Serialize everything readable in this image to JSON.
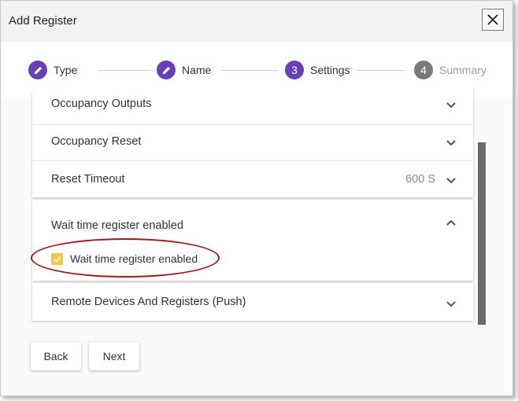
{
  "dialog": {
    "title": "Add Register",
    "close_icon": "close-icon"
  },
  "stepper": {
    "steps": [
      {
        "label": "Type",
        "marker": "edit-icon",
        "state": "completed"
      },
      {
        "label": "Name",
        "marker": "edit-icon",
        "state": "completed"
      },
      {
        "label": "Settings",
        "number": "3",
        "state": "active"
      },
      {
        "label": "Summary",
        "number": "4",
        "state": "inactive"
      }
    ]
  },
  "panels": [
    {
      "title": "Occupancy Outputs",
      "value": "",
      "expanded": false
    },
    {
      "title": "Occupancy Reset",
      "value": "",
      "expanded": false
    },
    {
      "title": "Reset Timeout",
      "value": "600 S",
      "expanded": false
    },
    {
      "title": "Wait time register enabled",
      "value": "",
      "expanded": true
    },
    {
      "title": "Remote Devices And Registers (Push)",
      "value": "",
      "expanded": false
    }
  ],
  "wait_time": {
    "checkbox_label": "Wait time register enabled",
    "checked": true
  },
  "buttons": {
    "back": "Back",
    "next": "Next"
  },
  "colors": {
    "accent": "#6a3fb5",
    "inactive_step": "#7a7a7a",
    "checkbox": "#f5c842",
    "annotation": "#a01818"
  }
}
